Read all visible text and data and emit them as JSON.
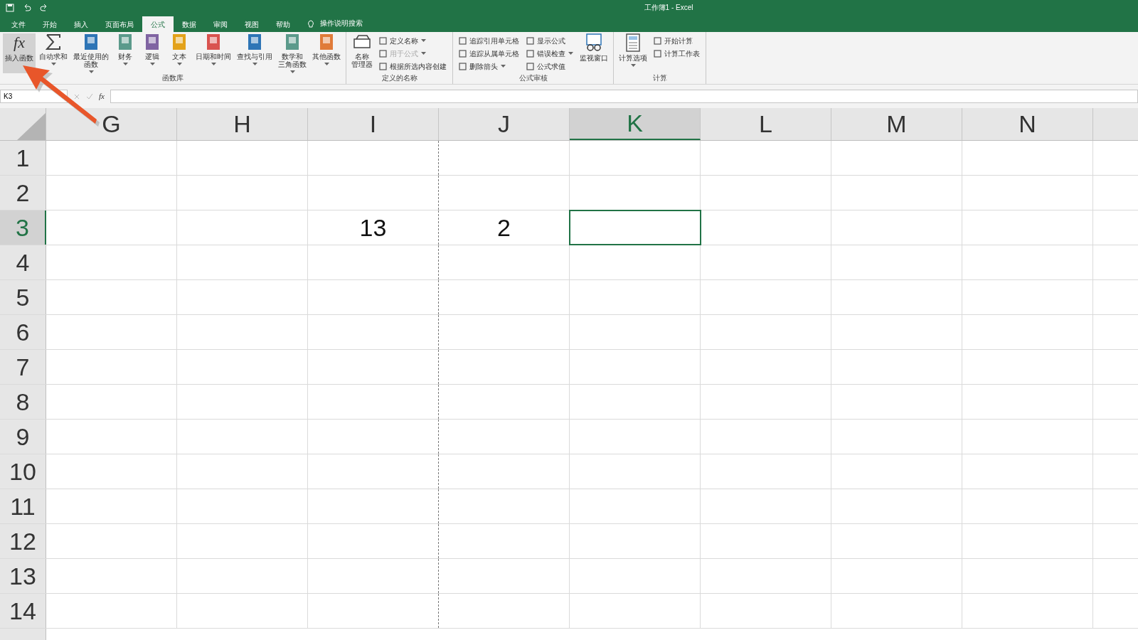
{
  "window": {
    "title": "工作簿1  -  Excel"
  },
  "tabs": [
    {
      "label": "文件",
      "selected": false
    },
    {
      "label": "开始",
      "selected": false
    },
    {
      "label": "插入",
      "selected": false
    },
    {
      "label": "页面布局",
      "selected": false
    },
    {
      "label": "公式",
      "selected": true
    },
    {
      "label": "数据",
      "selected": false
    },
    {
      "label": "审阅",
      "selected": false
    },
    {
      "label": "视图",
      "selected": false
    },
    {
      "label": "帮助",
      "selected": false
    }
  ],
  "tell_me": "操作说明搜索",
  "ribbon": [
    {
      "label": "函数库",
      "items": [
        {
          "kind": "large",
          "symbol": "fx",
          "lines": [
            "插入函数"
          ],
          "has_menu": false,
          "hovered": true
        },
        {
          "kind": "large",
          "lines": [
            "自动求和"
          ],
          "has_menu": true,
          "hovered": false
        },
        {
          "kind": "large",
          "lines": [
            "最近使用的",
            "函数"
          ],
          "has_menu": true,
          "hovered": false
        },
        {
          "kind": "large",
          "lines": [
            "财务"
          ],
          "has_menu": true,
          "hovered": false
        },
        {
          "kind": "large",
          "lines": [
            "逻辑"
          ],
          "has_menu": true,
          "hovered": false
        },
        {
          "kind": "large",
          "lines": [
            "文本"
          ],
          "has_menu": true,
          "hovered": false
        },
        {
          "kind": "large",
          "lines": [
            "日期和时间"
          ],
          "has_menu": true,
          "hovered": false
        },
        {
          "kind": "large",
          "lines": [
            "查找与引用"
          ],
          "has_menu": true,
          "hovered": false
        },
        {
          "kind": "large",
          "lines": [
            "数学和",
            "三角函数"
          ],
          "has_menu": true,
          "hovered": false
        },
        {
          "kind": "large",
          "lines": [
            "其他函数"
          ],
          "has_menu": true,
          "hovered": false
        }
      ]
    },
    {
      "label": "定义的名称",
      "items": [
        {
          "kind": "large",
          "lines": [
            "名称",
            "管理器"
          ],
          "has_menu": false,
          "hovered": false
        },
        {
          "kind": "stack",
          "entries": [
            {
              "label": "定义名称",
              "has_menu": true,
              "disabled": false
            },
            {
              "label": "用于公式",
              "has_menu": true,
              "disabled": true
            },
            {
              "label": "根据所选内容创建",
              "has_menu": false,
              "disabled": false
            }
          ]
        }
      ]
    },
    {
      "label": "公式审核",
      "items": [
        {
          "kind": "stack",
          "entries": [
            {
              "label": "追踪引用单元格",
              "has_menu": false,
              "disabled": false
            },
            {
              "label": "追踪从属单元格",
              "has_menu": false,
              "disabled": false
            },
            {
              "label": "删除箭头",
              "has_menu": true,
              "disabled": false
            }
          ]
        },
        {
          "kind": "stack",
          "entries": [
            {
              "label": "显示公式",
              "has_menu": false,
              "disabled": false
            },
            {
              "label": "错误检查",
              "has_menu": true,
              "disabled": false
            },
            {
              "label": "公式求值",
              "has_menu": false,
              "disabled": false
            }
          ]
        },
        {
          "kind": "large",
          "lines": [
            "监视窗口"
          ],
          "has_menu": false,
          "hovered": false
        }
      ]
    },
    {
      "label": "计算",
      "items": [
        {
          "kind": "large",
          "lines": [
            "计算选项"
          ],
          "has_menu": true,
          "hovered": false
        },
        {
          "kind": "stack",
          "entries": [
            {
              "label": "开始计算",
              "has_menu": false,
              "disabled": false
            },
            {
              "label": "计算工作表",
              "has_menu": false,
              "disabled": false
            }
          ]
        }
      ]
    }
  ],
  "name_box": "K3",
  "formula_bar": {
    "symbol": "fx"
  },
  "columns": [
    {
      "label": "G",
      "selected": false
    },
    {
      "label": "H",
      "selected": false
    },
    {
      "label": "I",
      "selected": false
    },
    {
      "label": "J",
      "selected": false
    },
    {
      "label": "K",
      "selected": true
    },
    {
      "label": "L",
      "selected": false
    },
    {
      "label": "M",
      "selected": false
    },
    {
      "label": "N",
      "selected": false
    }
  ],
  "rows": [
    {
      "label": "1",
      "selected": false,
      "cells": [
        null,
        null,
        null,
        null,
        null,
        null,
        null,
        null
      ]
    },
    {
      "label": "2",
      "selected": false,
      "cells": [
        null,
        null,
        null,
        null,
        null,
        null,
        null,
        null
      ]
    },
    {
      "label": "3",
      "selected": true,
      "cells": [
        null,
        null,
        "13",
        "2",
        null,
        null,
        null,
        null
      ]
    },
    {
      "label": "4",
      "selected": false,
      "cells": [
        null,
        null,
        null,
        null,
        null,
        null,
        null,
        null
      ]
    },
    {
      "label": "5",
      "selected": false,
      "cells": [
        null,
        null,
        null,
        null,
        null,
        null,
        null,
        null
      ]
    },
    {
      "label": "6",
      "selected": false,
      "cells": [
        null,
        null,
        null,
        null,
        null,
        null,
        null,
        null
      ]
    },
    {
      "label": "7",
      "selected": false,
      "cells": [
        null,
        null,
        null,
        null,
        null,
        null,
        null,
        null
      ]
    },
    {
      "label": "8",
      "selected": false,
      "cells": [
        null,
        null,
        null,
        null,
        null,
        null,
        null,
        null
      ]
    },
    {
      "label": "9",
      "selected": false,
      "cells": [
        null,
        null,
        null,
        null,
        null,
        null,
        null,
        null
      ]
    },
    {
      "label": "10",
      "selected": false,
      "cells": [
        null,
        null,
        null,
        null,
        null,
        null,
        null,
        null
      ]
    },
    {
      "label": "11",
      "selected": false,
      "cells": [
        null,
        null,
        null,
        null,
        null,
        null,
        null,
        null
      ]
    },
    {
      "label": "12",
      "selected": false,
      "cells": [
        null,
        null,
        null,
        null,
        null,
        null,
        null,
        null
      ]
    },
    {
      "label": "13",
      "selected": false,
      "cells": [
        null,
        null,
        null,
        null,
        null,
        null,
        null,
        null
      ]
    },
    {
      "label": "14",
      "selected": false,
      "cells": [
        null,
        null,
        null,
        null,
        null,
        null,
        null,
        null
      ]
    }
  ]
}
